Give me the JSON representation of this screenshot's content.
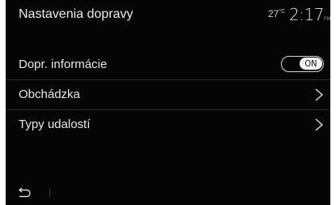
{
  "header": {
    "title": "Nastavenia dopravy",
    "temperature": "27",
    "temperature_unit": "°C",
    "time": "2:17",
    "time_suffix": "PM"
  },
  "menu": {
    "items": [
      {
        "label": "Dopr. informácie",
        "control": "toggle",
        "toggle_text": "ON",
        "toggle_state": "on"
      },
      {
        "label": "Obchádzka",
        "control": "chevron",
        "icon": "chevron-right-icon"
      },
      {
        "label": "Typy udalostí",
        "control": "chevron",
        "icon": "chevron-right-icon"
      }
    ]
  },
  "footer": {
    "back_icon": "back-arrow-icon"
  }
}
